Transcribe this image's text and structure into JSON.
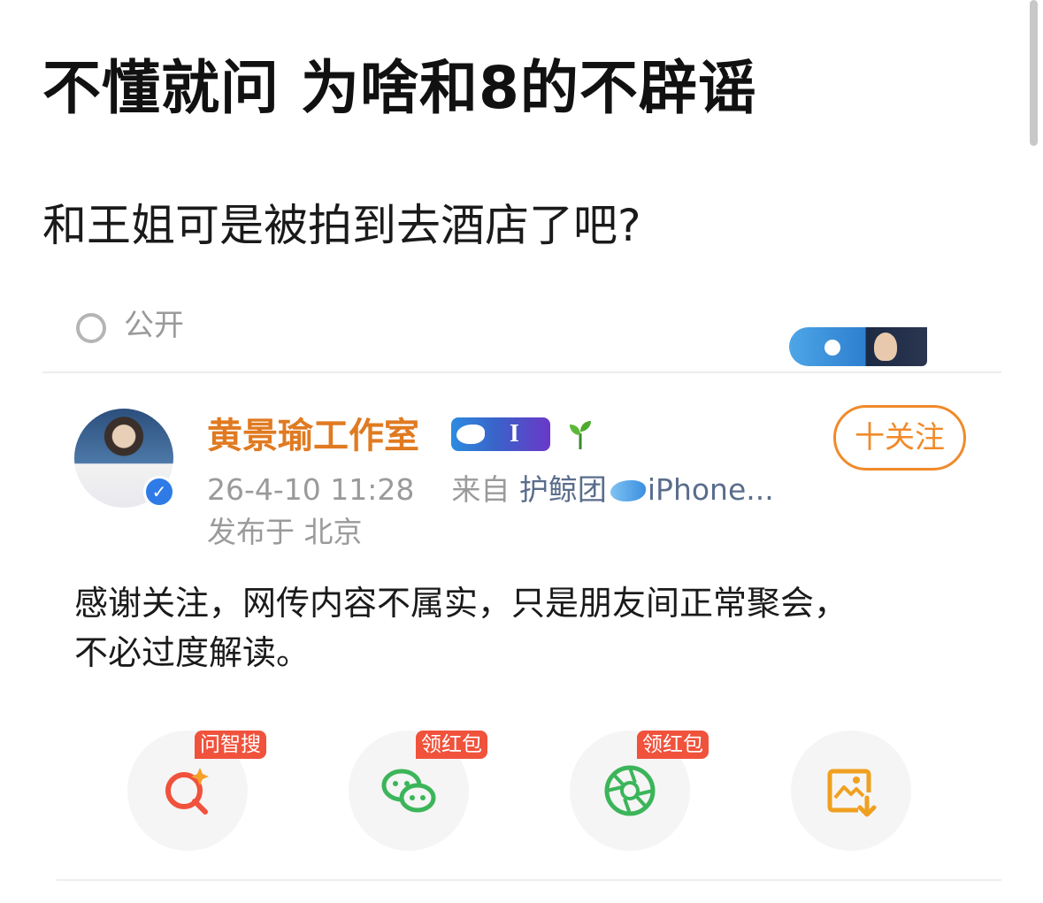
{
  "post": {
    "title": "不懂就问 为啥和8的不辟谣",
    "body": "和王姐可是被拍到去酒店了吧?"
  },
  "embed": {
    "cut_label": "公开",
    "account": {
      "name": "黄景瑜工作室",
      "badge_text": "I",
      "follow_label": "十关注",
      "timestamp": "26-4-10 11:28",
      "source_prefix": "来自",
      "source_name": "护鲸团",
      "device": "iPhone...",
      "location": "发布于 北京"
    },
    "text_lines": [
      "感谢关注，网传内容不属实，只是朋友间正常聚会，",
      "不必过度解读。"
    ],
    "actions": [
      {
        "icon": "ai-search-icon",
        "badge": "问智搜",
        "color": "#f0523c"
      },
      {
        "icon": "wechat-icon",
        "badge": "领红包",
        "color": "#3cb55a"
      },
      {
        "icon": "moments-icon",
        "badge": "领红包",
        "color": "#3cb55a"
      },
      {
        "icon": "save-image-icon",
        "badge": "",
        "color": "#f0a020"
      }
    ]
  },
  "colors": {
    "account_name": "#e07a21",
    "follow": "#f08a2a",
    "verified": "#2e7be8",
    "badge_red": "#f0523c"
  }
}
